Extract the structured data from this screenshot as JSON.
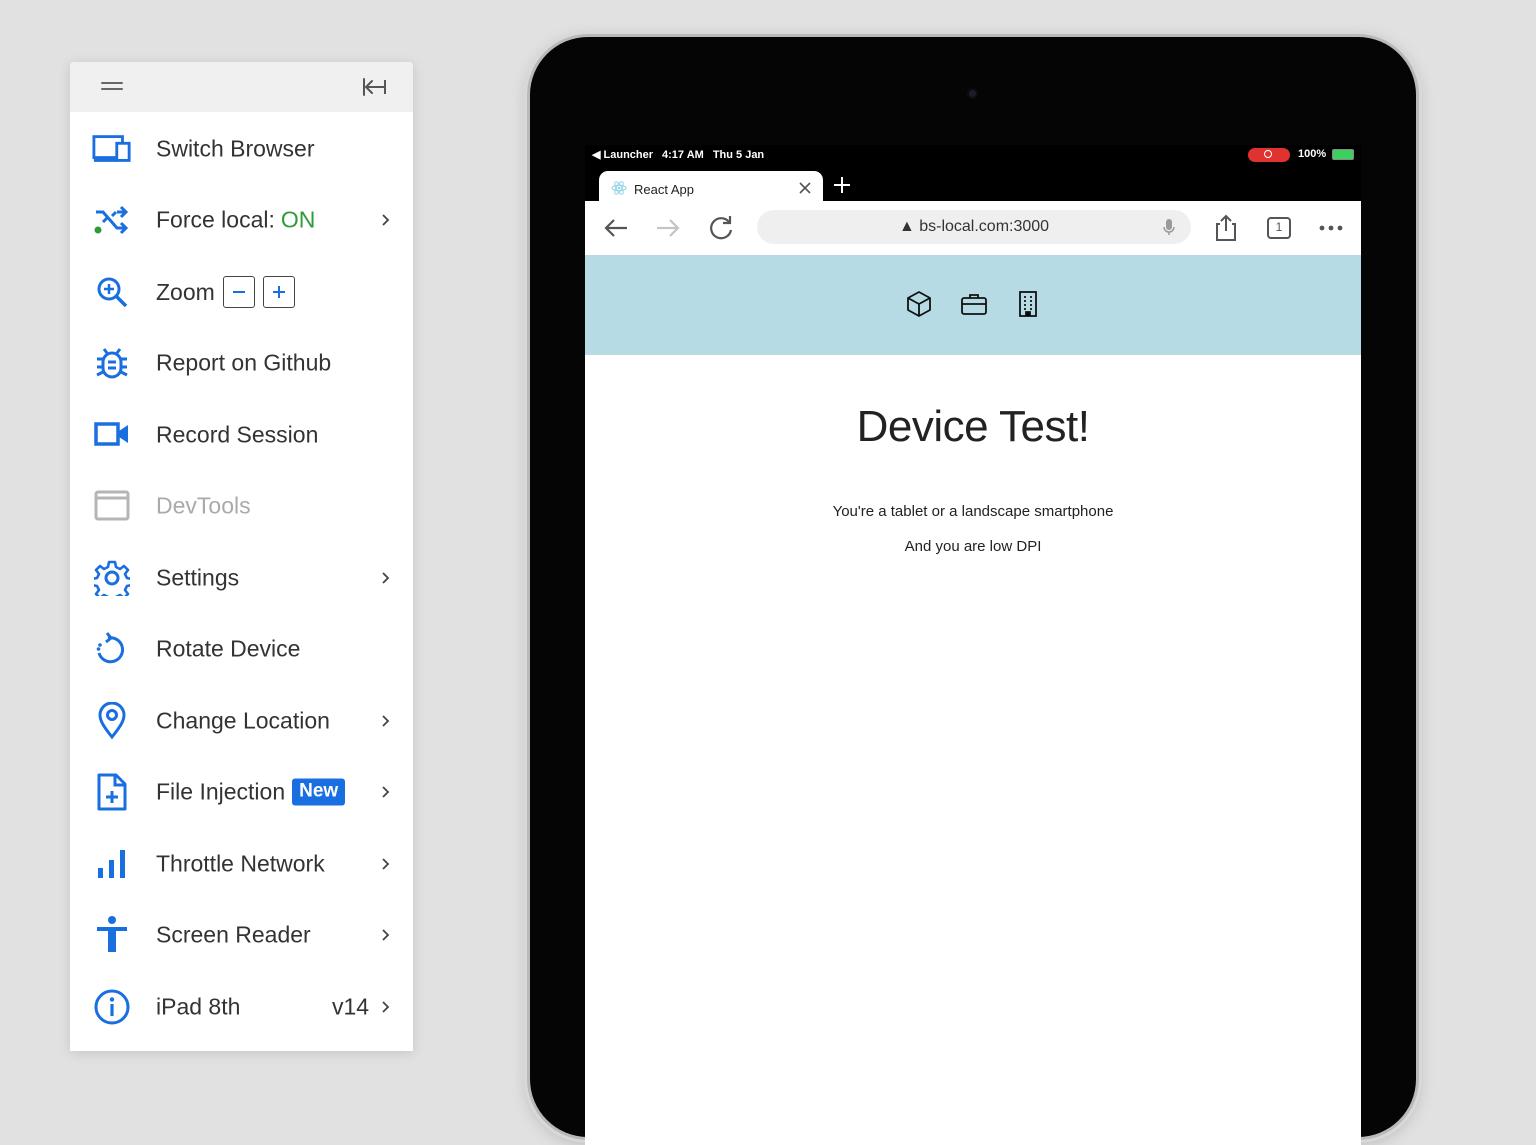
{
  "sidebar": {
    "items": [
      {
        "label": "Switch Browser",
        "icon": "switch-browser-icon"
      },
      {
        "label": "Force local:",
        "value": "ON",
        "icon": "shuffle-icon",
        "has_chevron": true
      },
      {
        "label": "Zoom",
        "icon": "zoom-in-icon",
        "zoom_out": "−",
        "zoom_in": "+"
      },
      {
        "label": "Report on Github",
        "icon": "bug-icon"
      },
      {
        "label": "Record Session",
        "icon": "video-camera-icon"
      },
      {
        "label": "DevTools",
        "icon": "window-icon",
        "disabled": true
      },
      {
        "label": "Settings",
        "icon": "gear-icon",
        "has_chevron": true
      },
      {
        "label": "Rotate Device",
        "icon": "rotate-icon"
      },
      {
        "label": "Change Location",
        "icon": "location-pin-icon",
        "has_chevron": true
      },
      {
        "label": "File Injection",
        "badge": "New",
        "icon": "file-add-icon",
        "has_chevron": true
      },
      {
        "label": "Throttle Network",
        "icon": "signal-bars-icon",
        "has_chevron": true
      },
      {
        "label": "Screen Reader",
        "icon": "accessibility-icon",
        "has_chevron": true
      },
      {
        "label": "iPad 8th",
        "version": "v14",
        "icon": "info-icon",
        "has_chevron": true
      }
    ]
  },
  "device": {
    "status": {
      "back_app": "◀ Launcher",
      "time": "4:17 AM",
      "date": "Thu 5 Jan",
      "battery": "100%"
    },
    "browser": {
      "tab_title": "React App",
      "new_tab": "+",
      "url": "▲ bs-local.com:3000",
      "tab_count": "1"
    },
    "page": {
      "heading": "Device Test!",
      "line1": "You're a tablet or a landscape smartphone",
      "line2": "And you are low DPI"
    }
  },
  "colors": {
    "accent": "#1a6fe0",
    "on_green": "#2e9b3a",
    "header_bg": "#b7dbe4",
    "record_red": "#e0322e"
  }
}
